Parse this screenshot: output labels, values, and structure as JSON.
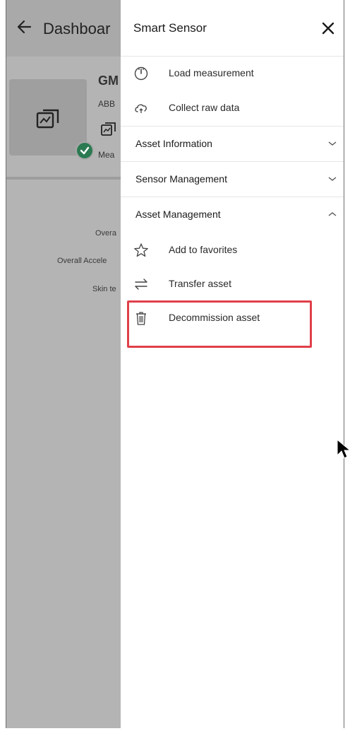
{
  "background": {
    "title": "Dashboar",
    "asset_name": "GM",
    "vendor": "ABB",
    "status": "Mea",
    "labels": [
      "Overa",
      "Overall Accele",
      "Skin te"
    ]
  },
  "drawer": {
    "title": "Smart Sensor",
    "quick_actions": [
      {
        "label": "Load measurement",
        "icon": "gauge-icon"
      },
      {
        "label": "Collect raw data",
        "icon": "cloud-sync-icon"
      }
    ],
    "sections": [
      {
        "label": "Asset Information",
        "expanded": false
      },
      {
        "label": "Sensor Management",
        "expanded": false
      },
      {
        "label": "Asset Management",
        "expanded": true
      }
    ],
    "asset_management_items": [
      {
        "label": "Add to favorites",
        "icon": "star-icon"
      },
      {
        "label": "Transfer asset",
        "icon": "transfer-icon"
      },
      {
        "label": "Decommission asset",
        "icon": "trash-icon"
      }
    ]
  },
  "colors": {
    "highlight": "#e0404a",
    "check_badge": "#2b7a51",
    "overlay": "#b4b4b4"
  }
}
